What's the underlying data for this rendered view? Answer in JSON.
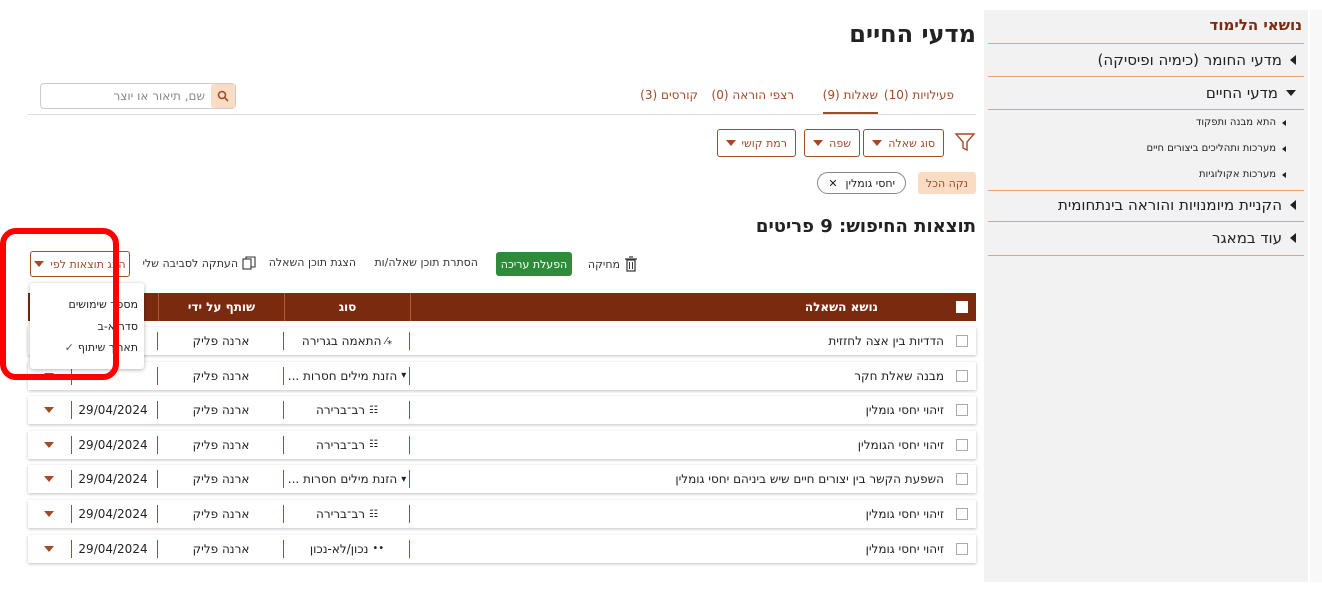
{
  "page_title": "מדעי החיים",
  "tabs": [
    {
      "label": "פעילויות (10)"
    },
    {
      "label": "שאלות (9)"
    },
    {
      "label": "רצפי הוראה (0)"
    },
    {
      "label": "קורסים (3)"
    }
  ],
  "search": {
    "placeholder": "שם, תיאור או יוצר"
  },
  "filters": [
    {
      "label": "סוג שאלה"
    },
    {
      "label": "שפה"
    },
    {
      "label": "רמת קושי"
    }
  ],
  "clear_all": "נקה הכל",
  "active_chip": "יחסי גומלין",
  "results_title": "תוצאות החיפוש: 9 פריטים",
  "actions": {
    "delete": "מחיקה",
    "edit": "הפעלת עריכה",
    "hide": "הסתרת תוכן שאלה/ות",
    "show": "הצגת תוכן השאלה",
    "copy": "העתקה לסביבה שלי",
    "sort_by": "הצג תוצאות לפי"
  },
  "sort_menu": [
    "מספר שימושים",
    "סדר א-ב",
    "תאריך שיתוף"
  ],
  "table": {
    "headers": {
      "subject": "נושא השאלה",
      "type": "סוג",
      "shared_by": "שותף על ידי"
    },
    "rows": [
      {
        "subject": "הדדיות בין אצה לחזזית",
        "type": "התאמה בגרירה",
        "type_icon": "drag-match-icon",
        "shared_by": "ארנה פליק",
        "date": ""
      },
      {
        "subject": "מבנה שאלת חקר",
        "type": "הזנת מילים חסרות ...",
        "type_icon": "dropdown-icon",
        "shared_by": "ארנה פליק",
        "date": ""
      },
      {
        "subject": "זיהוי יחסי גומלין",
        "type": "רב־ברירה",
        "type_icon": "list-icon",
        "shared_by": "ארנה פליק",
        "date": "29/04/2024"
      },
      {
        "subject": "זיהוי יחסי הגומלין",
        "type": "רב־ברירה",
        "type_icon": "list-icon",
        "shared_by": "ארנה פליק",
        "date": "29/04/2024"
      },
      {
        "subject": "השפעת הקשר בין יצורים חיים שיש ביניהם יחסי גומלין",
        "type": "הזנת מילים חסרות ...",
        "type_icon": "dropdown-icon",
        "shared_by": "ארנה פליק",
        "date": "29/04/2024"
      },
      {
        "subject": "זיהוי יחסי גומלין",
        "type": "רב־ברירה",
        "type_icon": "list-icon",
        "shared_by": "ארנה פליק",
        "date": "29/04/2024"
      },
      {
        "subject": "זיהוי יחסי גומלין",
        "type": "נכון/לא-נכון",
        "type_icon": "true-false-icon",
        "shared_by": "ארנה פליק",
        "date": "29/04/2024"
      }
    ]
  },
  "sidebar": {
    "title": "נושאי הלימוד",
    "items": [
      {
        "label": "מדעי החומר (כימיה ופיסיקה)"
      },
      {
        "label": "מדעי החיים"
      },
      {
        "label": "הקניית מיומנויות והוראה בינתחומית"
      },
      {
        "label": "עוד במאגר"
      }
    ],
    "subitems": [
      {
        "label": "התא מבנה ותפקוד"
      },
      {
        "label": "מערכות ותהליכים ביצורים חיים"
      },
      {
        "label": "מערכות אקולוגיות"
      }
    ]
  },
  "colors": {
    "brand": "#7a2a0f",
    "accent": "#a14b28",
    "edit_button": "#2e8b3a",
    "highlight": "#ff0000"
  }
}
